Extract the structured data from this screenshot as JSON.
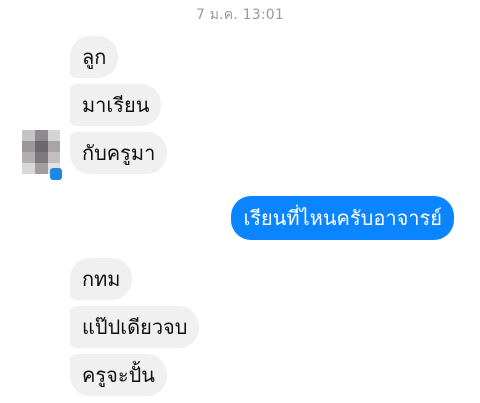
{
  "timestamp": "7 ม.ค. 13:01",
  "messages": [
    {
      "id": "m1",
      "direction": "incoming",
      "text": "ลูก"
    },
    {
      "id": "m2",
      "direction": "incoming",
      "text": "มาเรียน"
    },
    {
      "id": "m3",
      "direction": "incoming",
      "text": "กับครูมา"
    },
    {
      "id": "m4",
      "direction": "outgoing",
      "text": "เรียนที่ไหนครับอาจารย์"
    },
    {
      "id": "m5",
      "direction": "incoming",
      "text": "กทม"
    },
    {
      "id": "m6",
      "direction": "incoming",
      "text": "แป๊ปเดียวจบ"
    },
    {
      "id": "m7",
      "direction": "incoming",
      "text": "ครูจะปั้น"
    }
  ],
  "avatar": {
    "icon": "blurred-profile-avatar"
  },
  "colors": {
    "outgoing_bubble": "#0a84ff",
    "incoming_bubble": "#f1f0f0",
    "timestamp_text": "#9a9a9a"
  }
}
